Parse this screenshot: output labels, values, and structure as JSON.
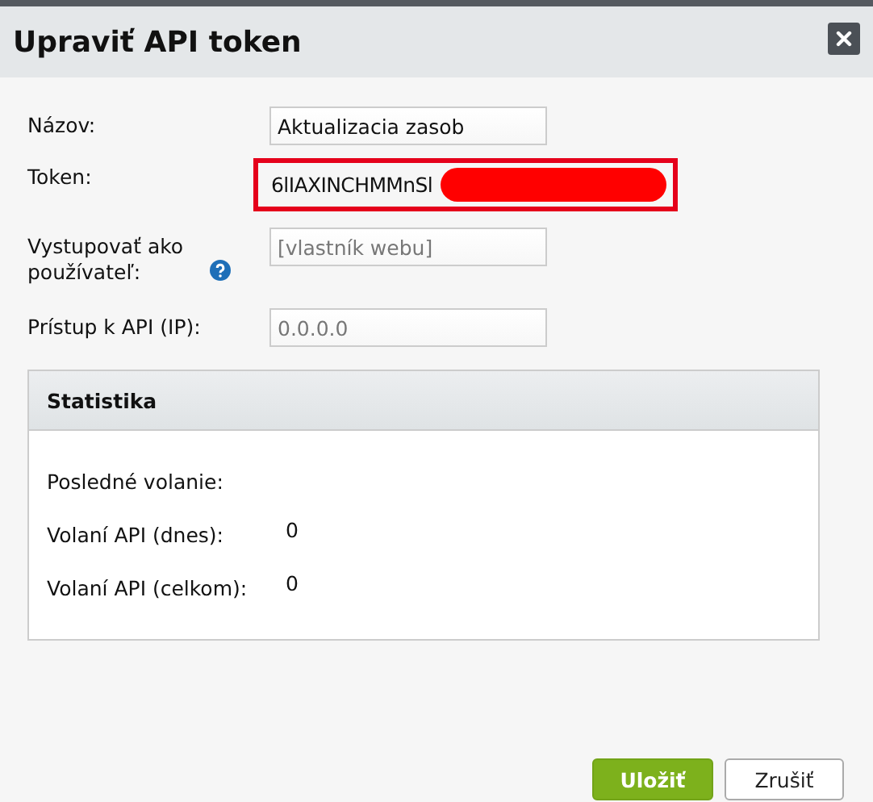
{
  "dialog": {
    "title": "Upraviť API token"
  },
  "fields": [
    {
      "kind": "input",
      "label": "Názov:",
      "value": "Aktualizacia zasob",
      "help": false
    },
    {
      "kind": "token",
      "label": "Token:",
      "value": "6lIAXINCHMMnSl",
      "highlighted": true,
      "redacted": true
    },
    {
      "kind": "input",
      "label": "Vystupovať ako používateľ:",
      "placeholder": "[vlastník webu]",
      "help": true
    },
    {
      "kind": "input",
      "label": "Prístup k API (IP):",
      "placeholder": "0.0.0.0",
      "help": false
    }
  ],
  "statistics": {
    "title": "Statistika",
    "rows": [
      {
        "label": "Posledné volanie:"
      },
      {
        "label": "Volaní API (dnes):",
        "value": "0"
      },
      {
        "label": "Volaní API (celkom):",
        "value": "0"
      }
    ]
  },
  "buttons": [
    {
      "label": "Uložiť",
      "kind": "primary"
    },
    {
      "label": "Zrušiť",
      "kind": "secondary"
    }
  ]
}
